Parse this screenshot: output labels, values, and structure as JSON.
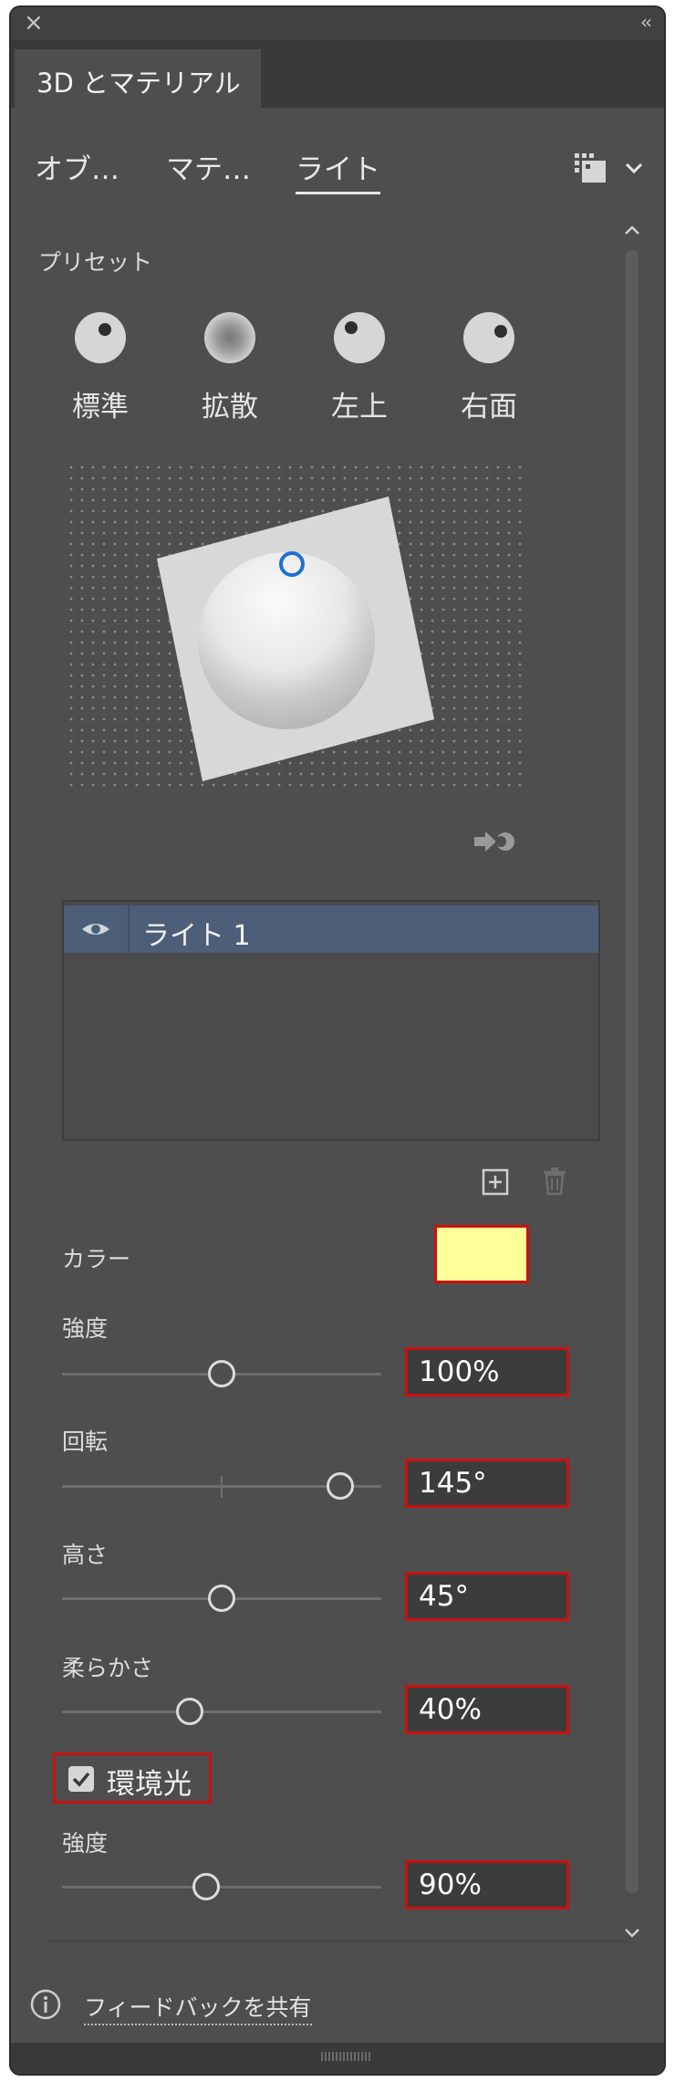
{
  "window": {
    "close_icon": "close-icon",
    "collapse_glyph": "‹‹"
  },
  "panel_tab": "3D とマテリアル",
  "tabs": [
    {
      "label": "オブ…",
      "active": false
    },
    {
      "label": "マテ…",
      "active": false
    },
    {
      "label": "ライト",
      "active": true
    }
  ],
  "presets": {
    "heading": "プリセット",
    "items": [
      {
        "label": "標準"
      },
      {
        "label": "拡散"
      },
      {
        "label": "左上"
      },
      {
        "label": "右面"
      }
    ]
  },
  "lights": {
    "items": [
      {
        "label": "ライト 1",
        "visible": true,
        "selected": true
      }
    ]
  },
  "properties": {
    "color_label": "カラー",
    "color_value": "#ffff99",
    "intensity_label": "強度",
    "intensity_value": "100%",
    "intensity_fraction": 0.5,
    "rotation_label": "回転",
    "rotation_value": "145°",
    "rotation_fraction": 0.87,
    "height_label": "高さ",
    "height_value": "45°",
    "height_fraction": 0.5,
    "softness_label": "柔らかさ",
    "softness_value": "40%",
    "softness_fraction": 0.4,
    "ambient_label": "環境光",
    "ambient_checked": true,
    "ambient_intensity_label": "強度",
    "ambient_intensity_value": "90%",
    "ambient_intensity_fraction": 0.45
  },
  "footer": {
    "feedback_label": "フィードバックを共有"
  },
  "colors": {
    "panel_bg": "#4e4e4e",
    "selection": "#4c5e78",
    "handle_blue": "#1f6fd0",
    "highlight_red": "#cc1010"
  }
}
